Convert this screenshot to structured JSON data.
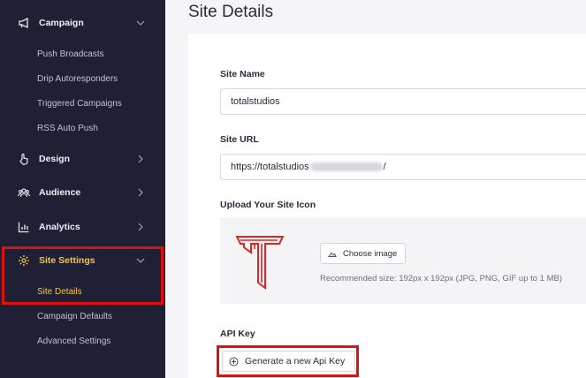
{
  "sidebar": {
    "campaign": {
      "label": "Campaign",
      "icon": "megaphone-icon"
    },
    "campaign_items": [
      "Push Broadcasts",
      "Drip Autoresponders",
      "Triggered Campaigns",
      "RSS Auto Push"
    ],
    "design": {
      "label": "Design",
      "icon": "pointer-hand-icon"
    },
    "audience": {
      "label": "Audience",
      "icon": "users-icon"
    },
    "analytics": {
      "label": "Analytics",
      "icon": "bar-chart-icon"
    },
    "site_settings": {
      "label": "Site Settings",
      "icon": "gear-icon"
    },
    "settings_items": [
      "Site Details",
      "Campaign Defaults",
      "Advanced Settings"
    ],
    "active_color": "#f3c54a",
    "highlight_color": "#e01010"
  },
  "main": {
    "title": "Site Details",
    "site_name_label": "Site Name",
    "site_name_value": "totalstudios",
    "site_url_label": "Site URL",
    "site_url_prefix": "https://totalstudios",
    "site_url_suffix": "/",
    "upload_label": "Upload Your Site Icon",
    "choose_image_label": "Choose image",
    "recommended_text": "Recommended size: 192px x 192px (JPG, PNG, GIF up to 1 MB)",
    "api_key_label": "API Key",
    "generate_button_label": "Generate a new Api Key"
  }
}
